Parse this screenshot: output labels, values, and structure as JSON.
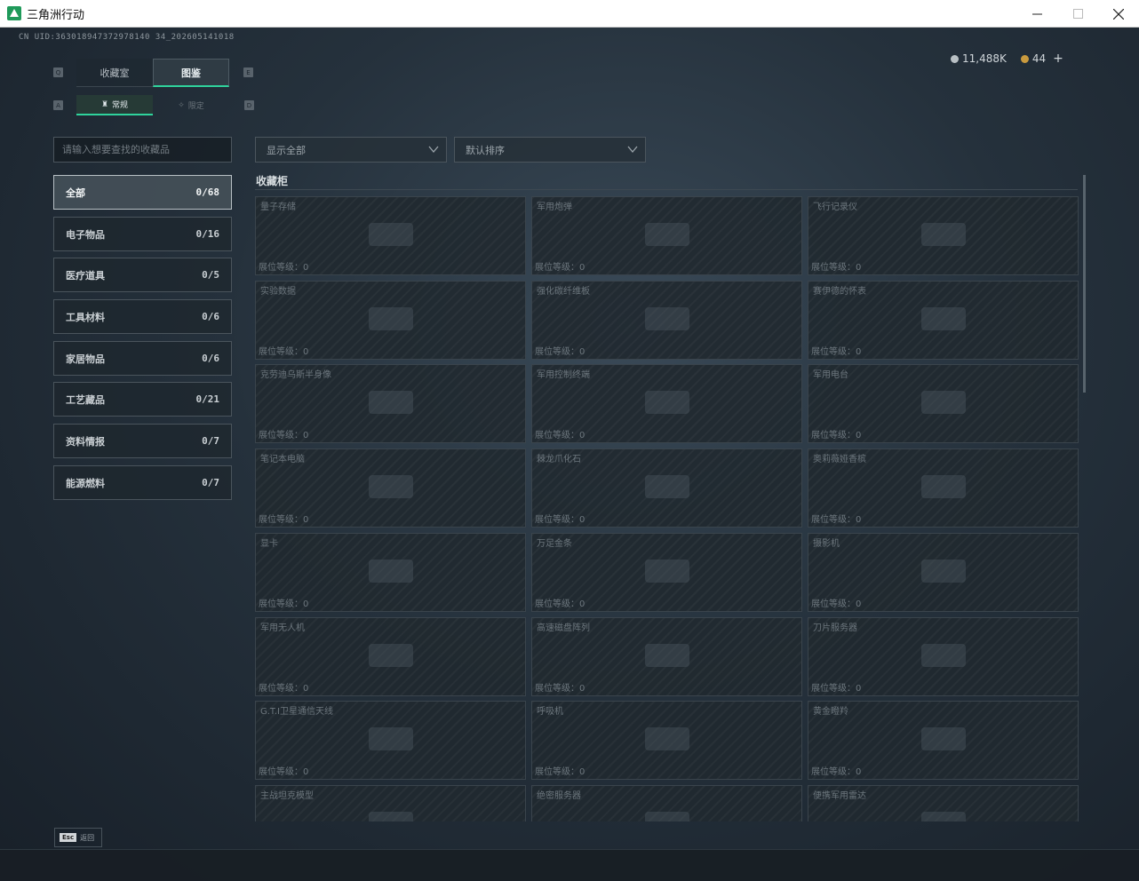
{
  "window": {
    "title": "三角洲行动",
    "minimize_icon": "minimize-icon",
    "maximize_icon": "maximize-icon",
    "close_icon": "close-icon"
  },
  "uid": "CN UID:363018947372978140 34_202605141018",
  "currency": {
    "silver_amount": "11,488K",
    "gold_amount": "44",
    "add_label": "+",
    "colors": {
      "silver": "#b9c0c4",
      "gold": "#c99a3e"
    }
  },
  "tabs": [
    {
      "label": "收藏室",
      "active": false
    },
    {
      "label": "图鉴",
      "active": true
    }
  ],
  "tab_keys": {
    "left": "Q",
    "right": "E"
  },
  "subtabs": [
    {
      "label": "常规",
      "icon": "bottle-icon",
      "active": true
    },
    {
      "label": "限定",
      "icon": "star-icon",
      "active": false
    }
  ],
  "subtab_keys": {
    "left": "A",
    "right": "D"
  },
  "search": {
    "placeholder": "请输入想要查找的收藏品"
  },
  "filter_dropdown": {
    "value": "显示全部"
  },
  "sort_dropdown": {
    "value": "默认排序"
  },
  "categories": [
    {
      "label": "全部",
      "count": "0/68",
      "active": true
    },
    {
      "label": "电子物品",
      "count": "0/16"
    },
    {
      "label": "医疗道具",
      "count": "0/5"
    },
    {
      "label": "工具材料",
      "count": "0/6"
    },
    {
      "label": "家居物品",
      "count": "0/6"
    },
    {
      "label": "工艺藏品",
      "count": "0/21"
    },
    {
      "label": "资料情报",
      "count": "0/7"
    },
    {
      "label": "能源燃料",
      "count": "0/7"
    }
  ],
  "section_title": "收藏柜",
  "level_label": "展位等级：0",
  "items": [
    {
      "name": "量子存储"
    },
    {
      "name": "军用炮弹"
    },
    {
      "name": "飞行记录仪"
    },
    {
      "name": "实验数据"
    },
    {
      "name": "强化碳纤维板"
    },
    {
      "name": "赛伊德的怀表"
    },
    {
      "name": "克劳迪乌斯半身像"
    },
    {
      "name": "军用控制终端"
    },
    {
      "name": "军用电台"
    },
    {
      "name": "笔记本电脑"
    },
    {
      "name": "棘龙爪化石"
    },
    {
      "name": "奥莉薇娅香槟"
    },
    {
      "name": "显卡"
    },
    {
      "name": "万足金条"
    },
    {
      "name": "摄影机"
    },
    {
      "name": "军用无人机"
    },
    {
      "name": "高速磁盘阵列"
    },
    {
      "name": "刀片服务器"
    },
    {
      "name": "G.T.I卫星通信天线"
    },
    {
      "name": "呼吸机"
    },
    {
      "name": "黄金瞪羚"
    },
    {
      "name": "主战坦克模型"
    },
    {
      "name": "绝密服务器"
    },
    {
      "name": "便携军用雷达"
    }
  ],
  "footer": {
    "esc_key": "Esc",
    "back_label": "返回"
  },
  "accent_color": "#2fd39c"
}
